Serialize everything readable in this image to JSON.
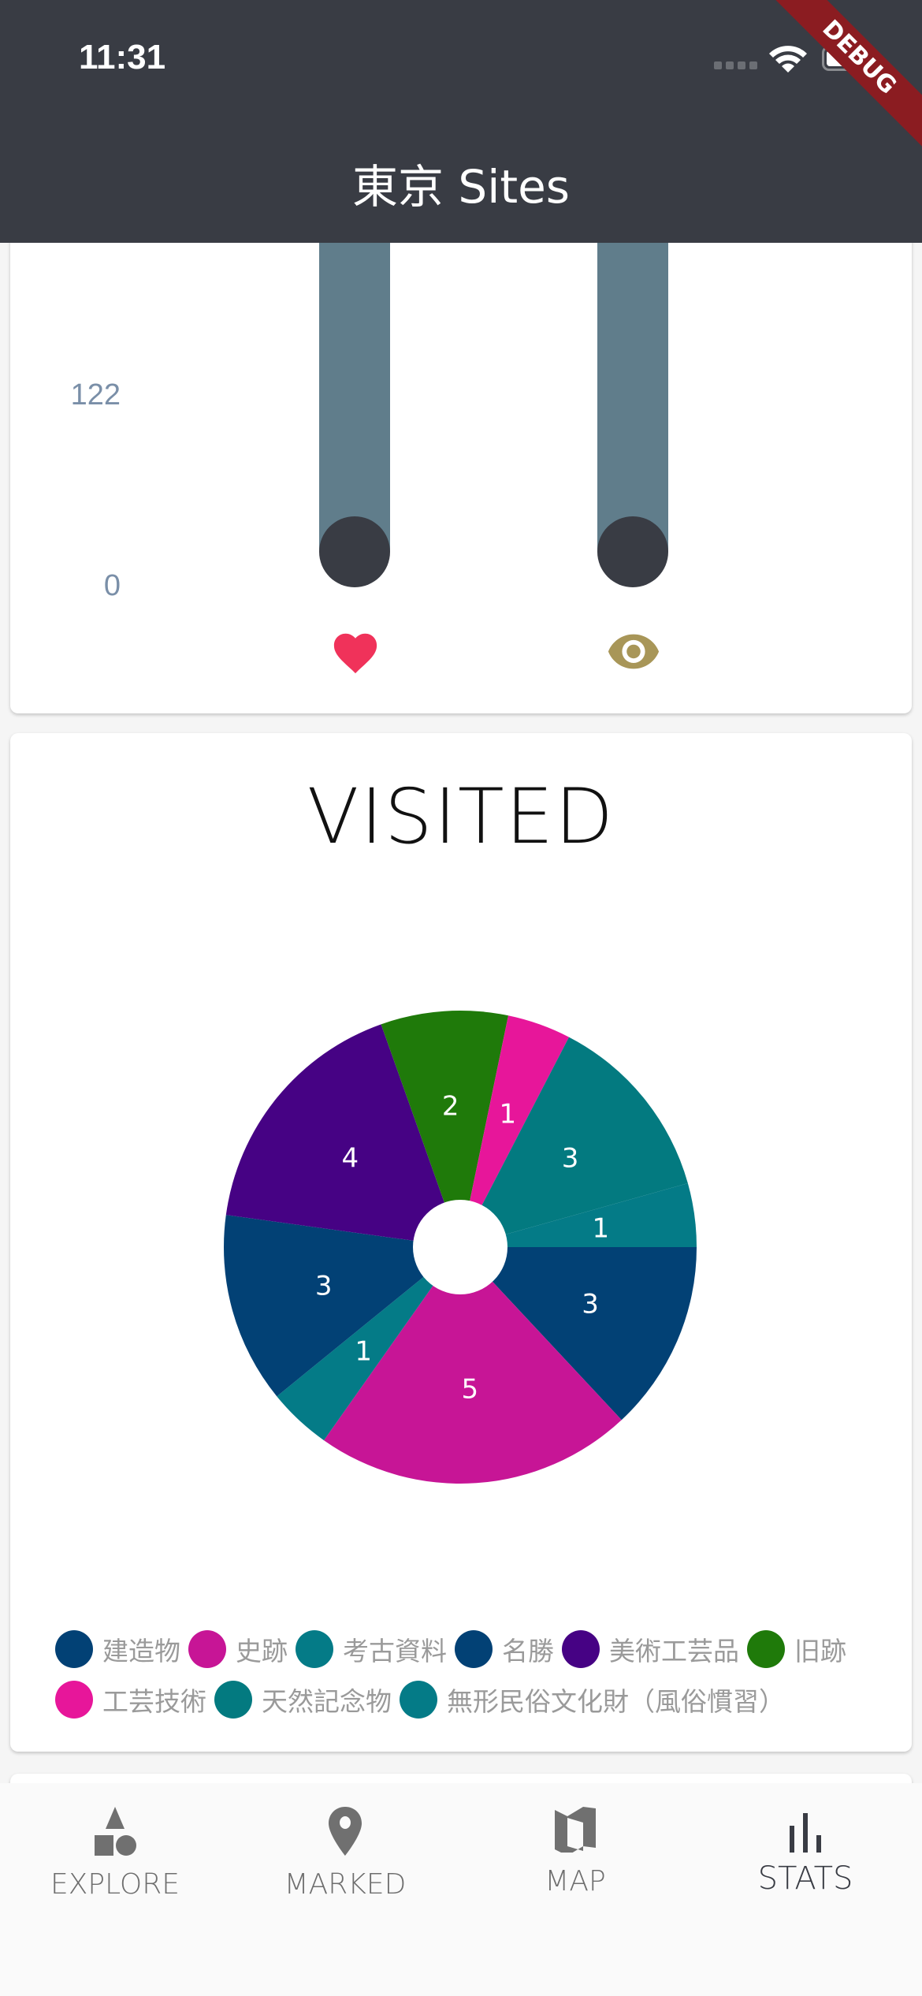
{
  "status_bar": {
    "time": "11:31"
  },
  "header": {
    "title": "東京 Sites",
    "debug_banner": "DEBUG"
  },
  "bar_card": {
    "chart_data": {
      "type": "bar",
      "yticks": [
        "122",
        "0"
      ],
      "categories": [
        "favorite-heart-icon",
        "visited-eye-icon"
      ],
      "colors": {
        "bar": "#607d8b",
        "knob": "#393c44",
        "heart": "#f0325a",
        "eye": "#a89658"
      }
    }
  },
  "visited_card": {
    "title": "VISITED",
    "chart_data": {
      "type": "pie",
      "donut": true,
      "start": "3 o'clock, clockwise",
      "categories": [
        "建造物",
        "史跡",
        "考古資料",
        "名勝",
        "美術工芸品",
        "旧跡",
        "工芸技術",
        "天然記念物",
        "無形民俗文化財（風俗慣習）"
      ],
      "values": [
        3,
        5,
        1,
        3,
        4,
        2,
        1,
        3,
        1
      ],
      "colors": [
        "#024175",
        "#c71596",
        "#047b87",
        "#024175",
        "#460284",
        "#1f7a0a",
        "#e7169a",
        "#037a80",
        "#047b87"
      ],
      "legend": "bottom"
    }
  },
  "nav": {
    "items": [
      {
        "label": "EXPLORE",
        "icon": "shapes-icon"
      },
      {
        "label": "MARKED",
        "icon": "location-pin-icon"
      },
      {
        "label": "MAP",
        "icon": "map-icon"
      },
      {
        "label": "STATS",
        "icon": "bar-chart-icon",
        "active": true
      }
    ]
  }
}
